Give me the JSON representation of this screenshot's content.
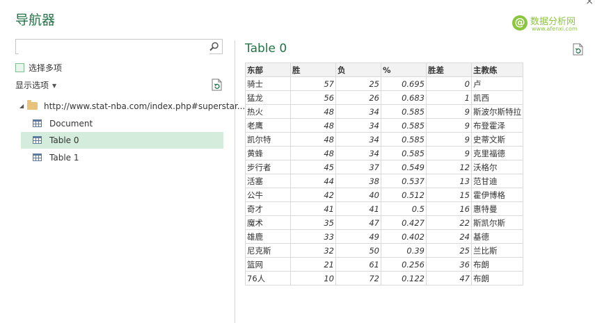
{
  "header": {
    "title": "导航器",
    "close_glyph": "×",
    "logo": {
      "mark": "@",
      "name": "数据分析网",
      "url": "www.afenxi.com"
    }
  },
  "left": {
    "search": {
      "value": "",
      "placeholder": ""
    },
    "multi_select_label": "选择多项",
    "display_options_label": "显示选项",
    "tree": {
      "root": "http://www.stat-nba.com/index.php#superstar...",
      "items": [
        {
          "label": "Document",
          "selected": false
        },
        {
          "label": "Table 0",
          "selected": true
        },
        {
          "label": "Table 1",
          "selected": false
        }
      ]
    }
  },
  "preview": {
    "title": "Table 0",
    "columns": [
      "东部",
      "胜",
      "负",
      "%",
      "胜差",
      "主教练"
    ],
    "rows": [
      [
        "骑士",
        "57",
        "25",
        "0.695",
        "0",
        "卢"
      ],
      [
        "猛龙",
        "56",
        "26",
        "0.683",
        "1",
        "凯西"
      ],
      [
        "热火",
        "48",
        "34",
        "0.585",
        "9",
        "斯波尔斯特拉"
      ],
      [
        "老鹰",
        "48",
        "34",
        "0.585",
        "9",
        "布登霍泽"
      ],
      [
        "凯尔特",
        "48",
        "34",
        "0.585",
        "9",
        "史蒂文斯"
      ],
      [
        "黄蜂",
        "48",
        "34",
        "0.585",
        "9",
        "克里福德"
      ],
      [
        "步行者",
        "45",
        "37",
        "0.549",
        "12",
        "沃格尔"
      ],
      [
        "活塞",
        "44",
        "38",
        "0.537",
        "13",
        "范甘迪"
      ],
      [
        "公牛",
        "42",
        "40",
        "0.512",
        "15",
        "霍伊博格"
      ],
      [
        "奇才",
        "41",
        "41",
        "0.5",
        "16",
        "惠特曼"
      ],
      [
        "魔术",
        "35",
        "47",
        "0.427",
        "22",
        "斯凯尔斯"
      ],
      [
        "雄鹿",
        "33",
        "49",
        "0.402",
        "24",
        "基德"
      ],
      [
        "尼克斯",
        "32",
        "50",
        "0.39",
        "25",
        "兰比斯"
      ],
      [
        "篮网",
        "21",
        "61",
        "0.256",
        "36",
        "布朗"
      ],
      [
        "76人",
        "10",
        "72",
        "0.122",
        "47",
        "布朗"
      ]
    ]
  },
  "colors": {
    "accent": "#217346",
    "selected_bg": "#d3ecdb",
    "logo_green": "#8cc63f"
  }
}
